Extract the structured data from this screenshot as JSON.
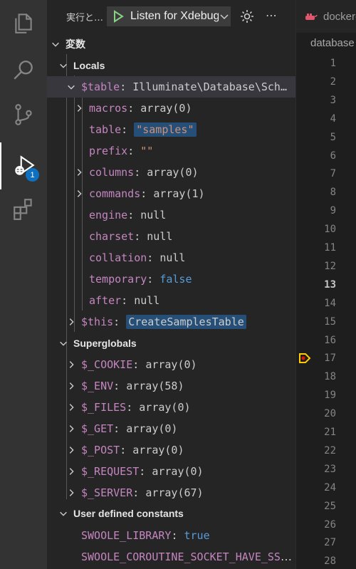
{
  "activity_bar": {
    "icons": [
      "files-icon",
      "search-icon",
      "source-control-icon",
      "run-debug-icon",
      "extensions-icon"
    ],
    "debug_badge": "1"
  },
  "debug_toolbar": {
    "run_label": "実行と…",
    "config_name": "Listen for Xdebug"
  },
  "variables": {
    "section_title": "変数",
    "locals": {
      "title": "Locals",
      "table": {
        "name": "$table",
        "value": "Illuminate\\Database\\Schema\\Blueprint"
      },
      "table_children": [
        {
          "name": "macros",
          "value": "array(0)",
          "type": "default",
          "expandable": true
        },
        {
          "name": "table",
          "value": "\"samples\"",
          "type": "string",
          "expandable": false,
          "highlight": true
        },
        {
          "name": "prefix",
          "value": "\"\"",
          "type": "string",
          "expandable": false
        },
        {
          "name": "columns",
          "value": "array(0)",
          "type": "default",
          "expandable": true
        },
        {
          "name": "commands",
          "value": "array(1)",
          "type": "default",
          "expandable": true
        },
        {
          "name": "engine",
          "value": "null",
          "type": "default",
          "expandable": false
        },
        {
          "name": "charset",
          "value": "null",
          "type": "default",
          "expandable": false
        },
        {
          "name": "collation",
          "value": "null",
          "type": "default",
          "expandable": false
        },
        {
          "name": "temporary",
          "value": "false",
          "type": "bool",
          "expandable": false
        },
        {
          "name": "after",
          "value": "null",
          "type": "default",
          "expandable": false
        }
      ],
      "this": {
        "name": "$this",
        "value": "CreateSamplesTable"
      }
    },
    "superglobals": {
      "title": "Superglobals",
      "items": [
        {
          "name": "$_COOKIE",
          "value": "array(0)"
        },
        {
          "name": "$_ENV",
          "value": "array(58)"
        },
        {
          "name": "$_FILES",
          "value": "array(0)"
        },
        {
          "name": "$_GET",
          "value": "array(0)"
        },
        {
          "name": "$_POST",
          "value": "array(0)"
        },
        {
          "name": "$_REQUEST",
          "value": "array(0)"
        },
        {
          "name": "$_SERVER",
          "value": "array(67)"
        }
      ]
    },
    "constants": {
      "title": "User defined constants",
      "items": [
        {
          "name": "SWOOLE_LIBRARY",
          "value": "true",
          "type": "bool"
        },
        {
          "name": "SWOOLE_COROUTINE_SOCKET_HAVE_SSL_HANDSHAKE",
          "value": "true",
          "type": "bool"
        }
      ]
    }
  },
  "editor": {
    "tab_label": "docker-compose.yml",
    "breadcrumb": "database",
    "line_numbers": [
      "1",
      "2",
      "3",
      "4",
      "5",
      "6",
      "7",
      "8",
      "9",
      "10",
      "11",
      "12",
      "13",
      "14",
      "15",
      "16",
      "17",
      "18",
      "19",
      "20",
      "21",
      "22",
      "23",
      "24",
      "25",
      "26",
      "27",
      "28"
    ],
    "current_line": "13",
    "breakpoint_line": "17"
  },
  "colors": {
    "accent": "#0e70c0",
    "variable_name": "#c586c0",
    "string_value": "#ce9178",
    "keyword_value": "#569cd6",
    "breakpoint": "#ffcc00"
  }
}
